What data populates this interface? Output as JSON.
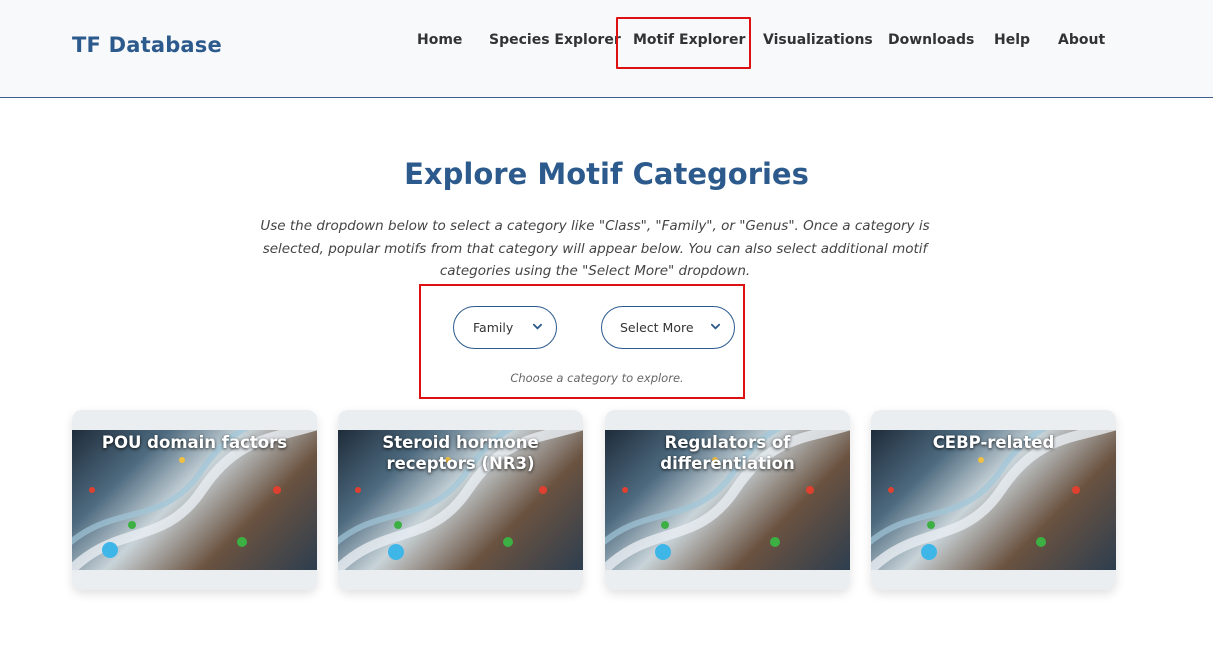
{
  "brand": "TF Database",
  "nav": [
    {
      "label": "Home"
    },
    {
      "label": "Species Explorer"
    },
    {
      "label": "Motif Explorer",
      "active": true
    },
    {
      "label": "Visualizations"
    },
    {
      "label": "Downloads"
    },
    {
      "label": "Help"
    },
    {
      "label": "About"
    }
  ],
  "main": {
    "title": "Explore Motif Categories",
    "description": "Use the dropdown below to select a category like \"Class\", \"Family\", or \"Genus\". Once a category is selected, popular motifs from that category will appear below. You can also select additional motif categories using the \"Select More\" dropdown.",
    "category_select": {
      "value": "Family"
    },
    "more_select": {
      "value": "Select More"
    },
    "hint": "Choose a category to explore."
  },
  "cards": [
    {
      "title": "POU domain factors",
      "image": "dna-helix-illustration"
    },
    {
      "title": "Steroid hormone receptors (NR3)",
      "image": "dna-helix-illustration"
    },
    {
      "title": "Regulators of differentiation",
      "image": "dna-helix-illustration"
    },
    {
      "title": "CEBP-related",
      "image": "dna-helix-illustration"
    }
  ],
  "colors": {
    "brand": "#2c5a8c",
    "highlight": "#dd1111",
    "card_bg": "#ebeef1"
  }
}
